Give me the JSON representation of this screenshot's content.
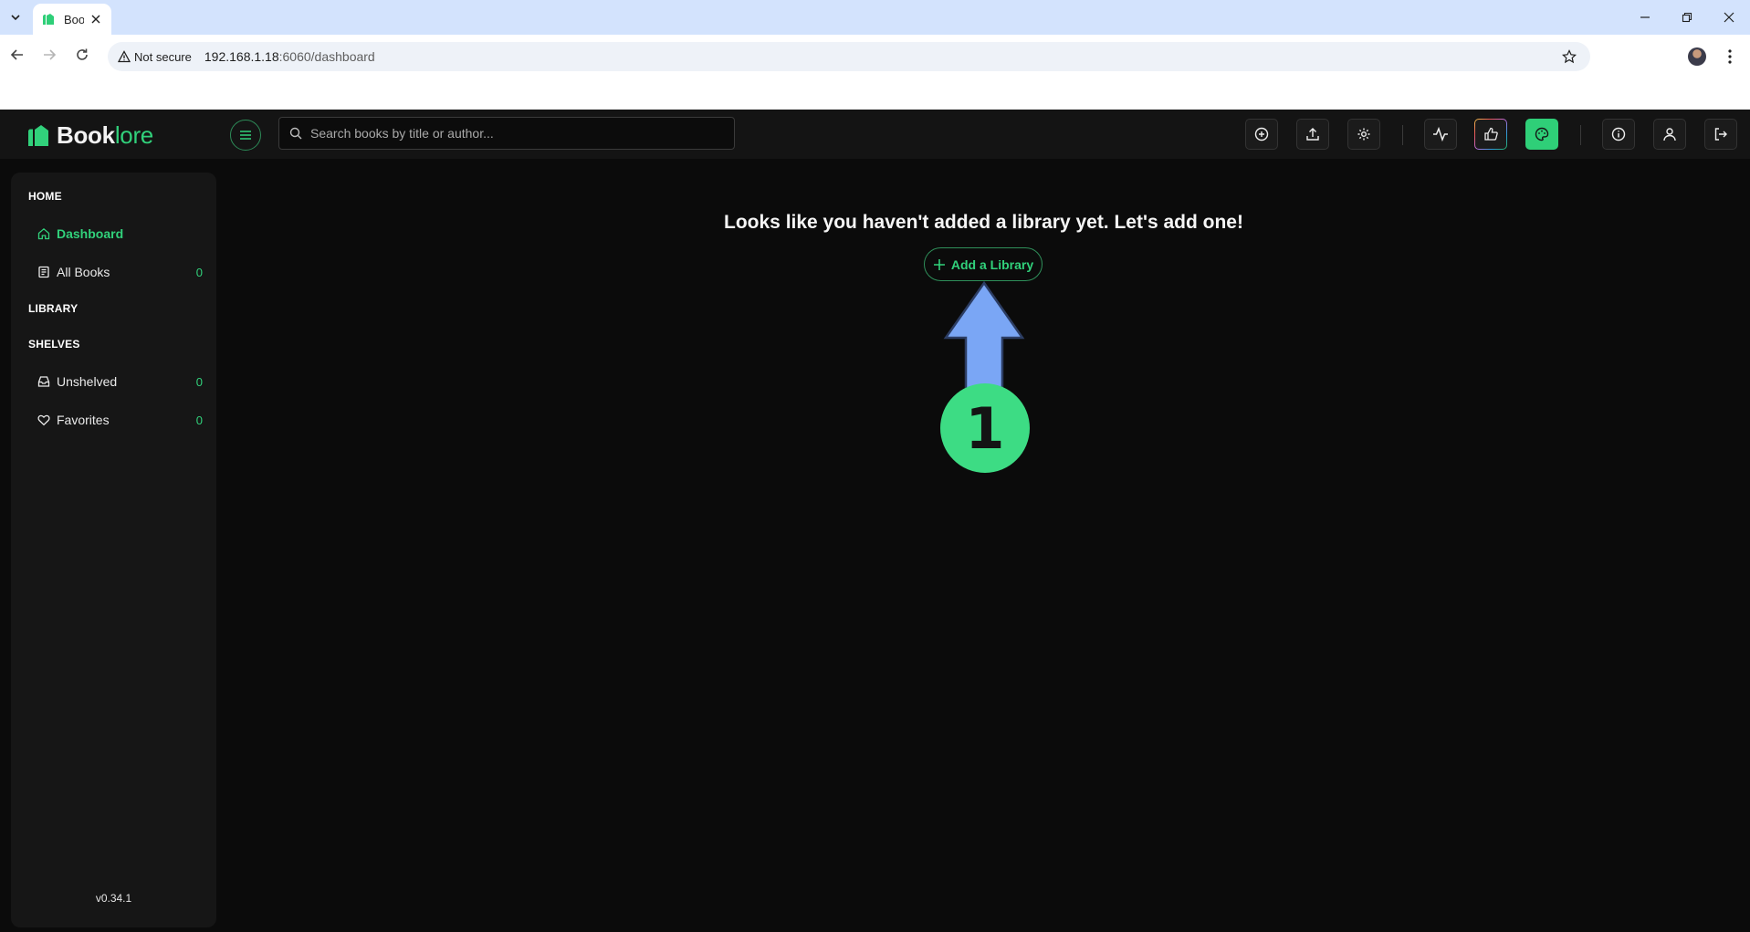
{
  "browser": {
    "tab_title": "Boo",
    "security_label": "Not secure",
    "url_host": "192.168.1.18",
    "url_rest": ":6060/dashboard"
  },
  "app": {
    "brand_main": "Book",
    "brand_accent": "lore",
    "accent_color": "#31d17b",
    "search_placeholder": "Search books by title or author...",
    "header_icons": [
      "add-circle-icon",
      "upload-icon",
      "gear-icon",
      "activity-icon",
      "thumbs-up-icon",
      "palette-icon",
      "info-icon",
      "user-icon",
      "logout-icon"
    ]
  },
  "sidebar": {
    "home_title": "HOME",
    "dashboard_label": "Dashboard",
    "all_books_label": "All Books",
    "all_books_count": "0",
    "library_title": "LIBRARY",
    "shelves_title": "SHELVES",
    "unshelved_label": "Unshelved",
    "unshelved_count": "0",
    "favorites_label": "Favorites",
    "favorites_count": "0",
    "version": "v0.34.1"
  },
  "main": {
    "empty_message": "Looks like you haven't added a library yet. Let's add one!",
    "add_library_label": "Add a Library",
    "callout_number": "1"
  }
}
